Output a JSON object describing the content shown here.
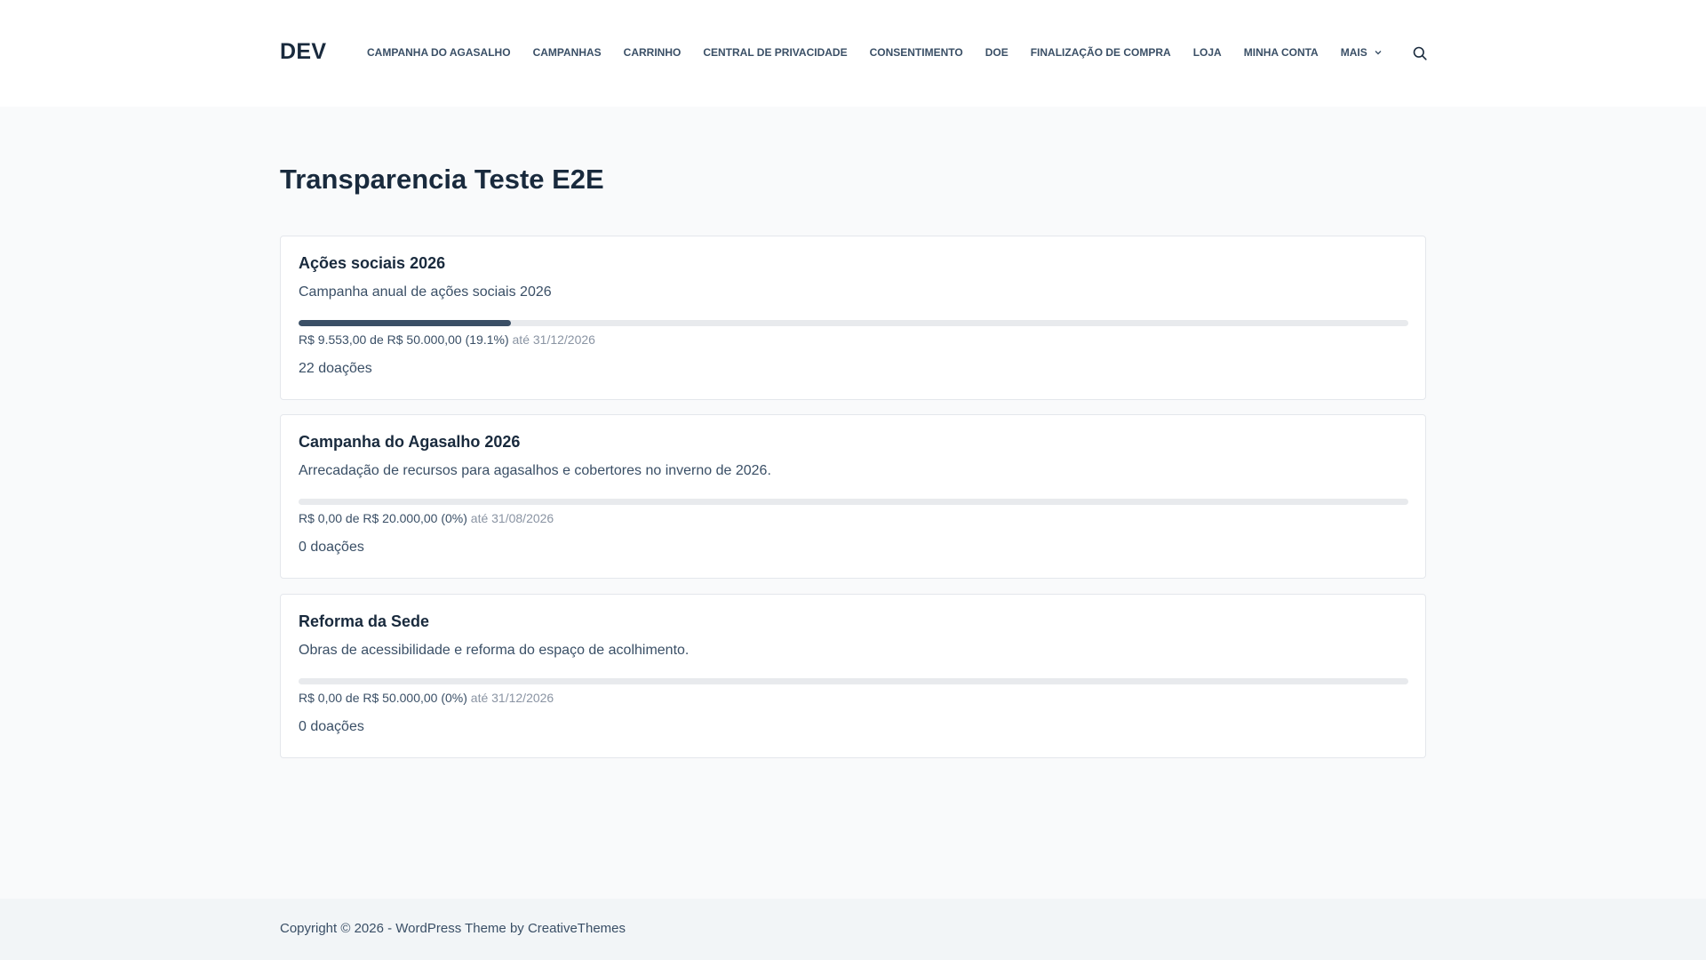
{
  "header": {
    "logo": "DEV",
    "nav": [
      {
        "label": "CAMPANHA DO AGASALHO"
      },
      {
        "label": "CAMPANHAS"
      },
      {
        "label": "CARRINHO"
      },
      {
        "label": "CENTRAL DE PRIVACIDADE"
      },
      {
        "label": "CONSENTIMENTO"
      },
      {
        "label": "DOE"
      },
      {
        "label": "FINALIZAÇÃO DE COMPRA"
      },
      {
        "label": "LOJA"
      },
      {
        "label": "MINHA CONTA"
      },
      {
        "label": "MAIS"
      }
    ],
    "search_icon": "search-icon",
    "more_icon": "chevron-down-icon"
  },
  "main": {
    "title": "Transparencia Teste E2E",
    "campaigns": [
      {
        "title": "Ações sociais 2026",
        "description": "Campanha anual de ações sociais 2026",
        "progress_percent": 19.1,
        "amount": "R$ 9.553,00 de R$ 50.000,00 (19.1%)",
        "deadline": "até 31/12/2026",
        "donations": "22 doações"
      },
      {
        "title": "Campanha do Agasalho 2026",
        "description": "Arrecadação de recursos para agasalhos e cobertores no inverno de 2026.",
        "progress_percent": 0,
        "amount": "R$ 0,00 de R$ 20.000,00 (0%)",
        "deadline": "até 31/08/2026",
        "donations": "0 doações"
      },
      {
        "title": "Reforma da Sede",
        "description": "Obras de acessibilidade e reforma do espaço de acolhimento.",
        "progress_percent": 0,
        "amount": "R$ 0,00 de R$ 50.000,00 (0%)",
        "deadline": "até 31/12/2026",
        "donations": "0 doações"
      }
    ]
  },
  "footer": {
    "prefix": "Copyright © 2026 - WordPress Theme by ",
    "link": "CreativeThemes"
  },
  "colors": {
    "progress_fill": "#3a4f66",
    "progress_track": "#e8eaed",
    "heading": "#192a3d",
    "text": "#3a4f66",
    "muted": "#8a94a3"
  }
}
